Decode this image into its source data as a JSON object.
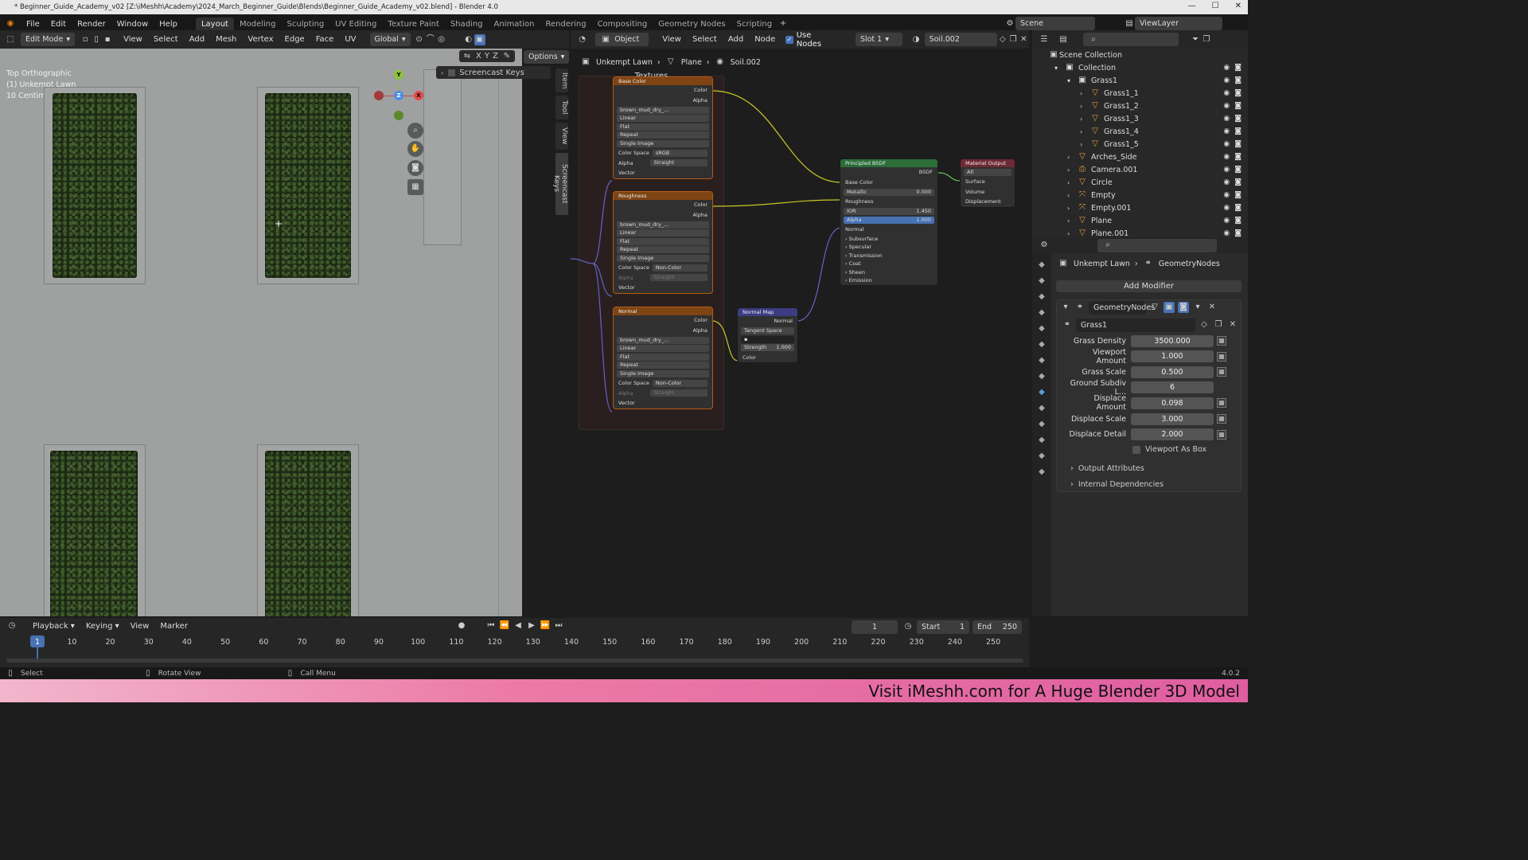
{
  "window": {
    "title": "* Beginner_Guide_Academy_v02 [Z:\\iMeshh\\Academy\\2024_March_Beginner_Guide\\Blends\\Beginner_Guide_Academy_v02.blend] - Blender 4.0"
  },
  "menubar": {
    "menus": [
      "File",
      "Edit",
      "Render",
      "Window",
      "Help"
    ],
    "workspaces": [
      "Layout",
      "Modeling",
      "Sculpting",
      "UV Editing",
      "Texture Paint",
      "Shading",
      "Animation",
      "Rendering",
      "Compositing",
      "Geometry Nodes",
      "Scripting"
    ],
    "active_workspace": "Layout",
    "scene": "Scene",
    "view_layer": "ViewLayer"
  },
  "viewport": {
    "mode": "Edit Mode",
    "menus": [
      "View",
      "Select",
      "Add",
      "Mesh",
      "Vertex",
      "Edge",
      "Face",
      "UV"
    ],
    "transform": "Global",
    "axes": [
      "X",
      "Y",
      "Z"
    ],
    "options": "Options",
    "info": [
      "Top Orthographic",
      "(1) Unkempt Lawn",
      "10 Centimeters"
    ],
    "screencast_panel": "Screencast Keys",
    "side_tabs": [
      "Item",
      "Tool",
      "View",
      "Screencast Keys"
    ],
    "gizmo": {
      "y": "Y",
      "z": "Z",
      "x": "X"
    }
  },
  "node_editor": {
    "object_mode": "Object",
    "menus": [
      "View",
      "Select",
      "Add",
      "Node"
    ],
    "use_nodes": "Use Nodes",
    "slot": "Slot 1",
    "material": "Soil.002",
    "breadcrumb": [
      "Unkempt Lawn",
      "Plane",
      "Soil.002"
    ],
    "frame_label": "Textures",
    "tex_nodes": [
      {
        "title": "Base Color",
        "image": "brown_mud_dry_...",
        "interp": "Linear",
        "proj": "Flat",
        "ext": "Repeat",
        "src": "Single Image",
        "colorspace_label": "Color Space",
        "colorspace": "sRGB",
        "alpha_label": "Alpha",
        "alpha": "Straight",
        "out_color": "Color",
        "out_alpha": "Alpha",
        "in_vector": "Vector"
      },
      {
        "title": "Roughness",
        "image": "brown_mud_dry_...",
        "interp": "Linear",
        "proj": "Flat",
        "ext": "Repeat",
        "src": "Single Image",
        "colorspace_label": "Color Space",
        "colorspace": "Non-Color",
        "alpha_label": "Alpha",
        "alpha": "Straight",
        "out_color": "Color",
        "out_alpha": "Alpha",
        "in_vector": "Vector"
      },
      {
        "title": "Normal",
        "image": "brown_mud_dry_...",
        "interp": "Linear",
        "proj": "Flat",
        "ext": "Repeat",
        "src": "Single Image",
        "colorspace_label": "Color Space",
        "colorspace": "Non-Color",
        "alpha_label": "Alpha",
        "alpha": "Straight",
        "out_color": "Color",
        "out_alpha": "Alpha",
        "in_vector": "Vector"
      }
    ],
    "normal_map": {
      "title": "Normal Map",
      "out": "Normal",
      "space": "Tangent Space",
      "strength_label": "Strength",
      "strength": "1.000",
      "in_color": "Color"
    },
    "bsdf": {
      "title": "Principled BSDF",
      "out": "BSDF",
      "base_color": "Base Color",
      "metallic_label": "Metallic",
      "metallic": "0.000",
      "roughness": "Roughness",
      "ior_label": "IOR",
      "ior": "1.450",
      "alpha_label": "Alpha",
      "alpha": "1.000",
      "normal": "Normal",
      "panels": [
        "Subsurface",
        "Specular",
        "Transmission",
        "Coat",
        "Sheen",
        "Emission"
      ]
    },
    "output": {
      "title": "Material Output",
      "target": "All",
      "surface": "Surface",
      "volume": "Volume",
      "displacement": "Displacement"
    }
  },
  "outliner": {
    "root": "Scene Collection",
    "items": [
      {
        "name": "Collection",
        "indent": 1
      },
      {
        "name": "Grass1",
        "indent": 2
      },
      {
        "name": "Grass1_1",
        "indent": 3
      },
      {
        "name": "Grass1_2",
        "indent": 3
      },
      {
        "name": "Grass1_3",
        "indent": 3
      },
      {
        "name": "Grass1_4",
        "indent": 3
      },
      {
        "name": "Grass1_5",
        "indent": 3
      },
      {
        "name": "Arches_Side",
        "indent": 2
      },
      {
        "name": "Camera.001",
        "indent": 2
      },
      {
        "name": "Circle",
        "indent": 2
      },
      {
        "name": "Empty",
        "indent": 2
      },
      {
        "name": "Empty.001",
        "indent": 2
      },
      {
        "name": "Plane",
        "indent": 2
      },
      {
        "name": "Plane.001",
        "indent": 2
      }
    ]
  },
  "properties": {
    "breadcrumb": [
      "Unkempt Lawn",
      "GeometryNodes"
    ],
    "add_modifier": "Add Modifier",
    "modifier_name": "GeometryNodes",
    "node_group": "Grass1",
    "fields": [
      {
        "label": "Grass Density",
        "value": "3500.000"
      },
      {
        "label": "Viewport Amount",
        "value": "1.000"
      },
      {
        "label": "Grass Scale",
        "value": "0.500"
      },
      {
        "label": "Ground Subdiv L...",
        "value": "6"
      },
      {
        "label": "Displace Amount",
        "value": "0.098"
      },
      {
        "label": "Displace Scale",
        "value": "3.000"
      },
      {
        "label": "Displace Detail",
        "value": "2.000"
      }
    ],
    "checkbox": "Viewport As Box",
    "sections": [
      "Output Attributes",
      "Internal Dependencies"
    ]
  },
  "timeline": {
    "menus": [
      "Playback",
      "Keying",
      "View",
      "Marker"
    ],
    "current_frame": "1",
    "start_label": "Start",
    "start": "1",
    "end_label": "End",
    "end": "250",
    "ticks": [
      "1",
      "10",
      "20",
      "30",
      "40",
      "50",
      "60",
      "70",
      "80",
      "90",
      "100",
      "110",
      "120",
      "130",
      "140",
      "150",
      "160",
      "170",
      "180",
      "190",
      "200",
      "210",
      "220",
      "230",
      "240",
      "250"
    ]
  },
  "statusbar": {
    "items": [
      "Select",
      "Rotate View",
      "Call Menu"
    ],
    "version": "4.0.2"
  },
  "banner": {
    "text": "Visit iMeshh.com for A Huge Blender 3D Model"
  }
}
